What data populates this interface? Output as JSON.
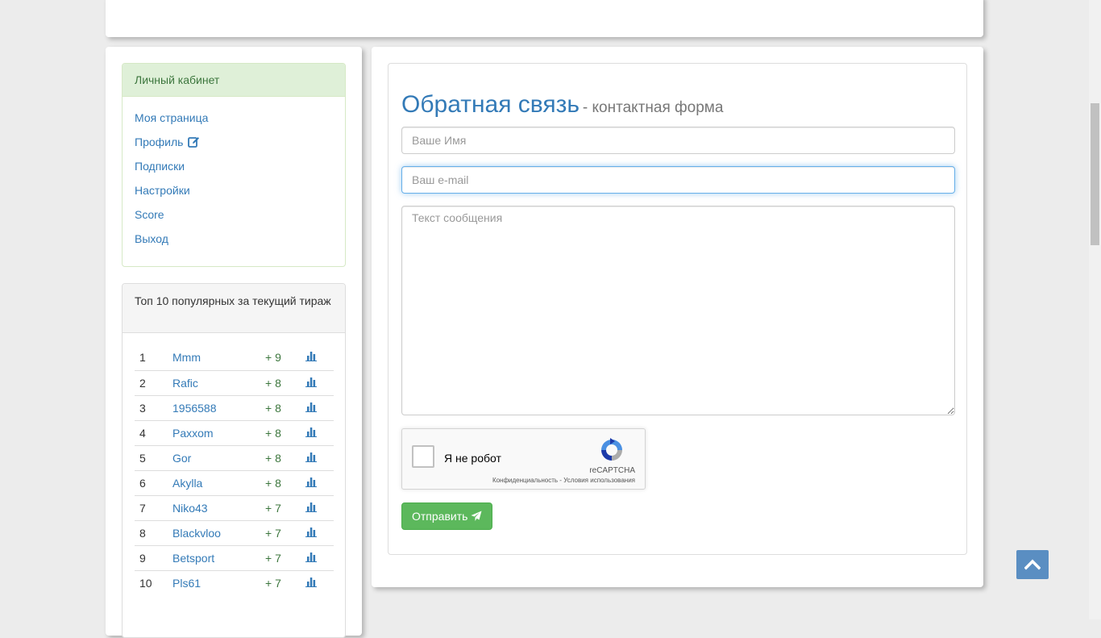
{
  "cabinet": {
    "title": "Личный кабинет",
    "items": [
      {
        "label": "Моя страница"
      },
      {
        "label": "Профиль",
        "icon": "edit-icon"
      },
      {
        "label": "Подписки"
      },
      {
        "label": "Настройки"
      },
      {
        "label": "Score"
      },
      {
        "label": "Выход"
      }
    ]
  },
  "top10": {
    "title": "Топ 10 популярных за текущий тираж",
    "rows": [
      {
        "rank": "1",
        "name": "Mmm",
        "score": "+ 9"
      },
      {
        "rank": "2",
        "name": "Rafic",
        "score": "+ 8"
      },
      {
        "rank": "3",
        "name": "1956588",
        "score": "+ 8"
      },
      {
        "rank": "4",
        "name": "Paxxom",
        "score": "+ 8"
      },
      {
        "rank": "5",
        "name": "Gor",
        "score": "+ 8"
      },
      {
        "rank": "6",
        "name": "Akylla",
        "score": "+ 8"
      },
      {
        "rank": "7",
        "name": "Niko43",
        "score": "+ 7"
      },
      {
        "rank": "8",
        "name": "Blackvloo",
        "score": "+ 7"
      },
      {
        "rank": "9",
        "name": "Betsport",
        "score": "+ 7"
      },
      {
        "rank": "10",
        "name": "Pls61",
        "score": "+ 7"
      }
    ],
    "stat_icon": "bar-chart-icon"
  },
  "form": {
    "title": "Обратная связь",
    "subtitle": "- контактная форма",
    "name_placeholder": "Ваше Имя",
    "email_placeholder": "Ваш e-mail",
    "message_placeholder": "Текст сообщения",
    "submit_label": "Отправить",
    "submit_icon": "paper-plane-icon"
  },
  "recaptcha": {
    "label": "Я не робот",
    "brand": "reCAPTCHA",
    "links": "Конфиденциальность - Условия использования"
  },
  "colors": {
    "link": "#337ab7",
    "success": "#5cb85c",
    "panel_success_bg": "#dff0d8",
    "score_green": "#3c763d"
  }
}
